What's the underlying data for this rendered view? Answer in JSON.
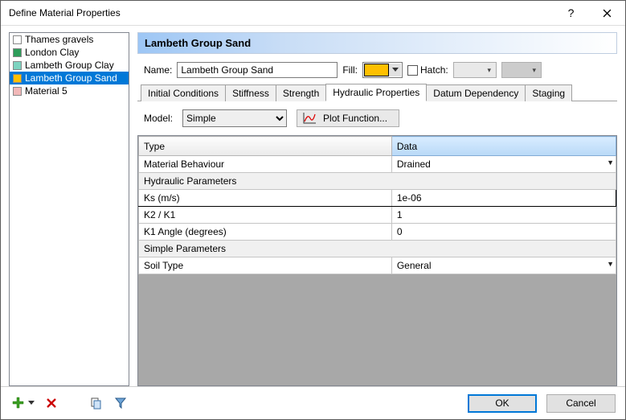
{
  "window": {
    "title": "Define Material Properties"
  },
  "sidebar": {
    "items": [
      {
        "label": "Thames gravels",
        "color": "#ffffff"
      },
      {
        "label": "London Clay",
        "color": "#2e9d5a"
      },
      {
        "label": "Lambeth Group Clay",
        "color": "#7dd3c0"
      },
      {
        "label": "Lambeth Group Sand",
        "color": "#ffc000"
      },
      {
        "label": "Material 5",
        "color": "#f2b8b8"
      }
    ],
    "selected_index": 3
  },
  "header": {
    "title": "Lambeth Group Sand"
  },
  "form": {
    "name_label": "Name:",
    "name_value": "Lambeth Group Sand",
    "fill_label": "Fill:",
    "fill_color": "#ffc000",
    "hatch_label": "Hatch:"
  },
  "tabs": {
    "items": [
      "Initial Conditions",
      "Stiffness",
      "Strength",
      "Hydraulic Properties",
      "Datum Dependency",
      "Staging"
    ],
    "active_index": 3
  },
  "model_row": {
    "label": "Model:",
    "value": "Simple",
    "plot_btn": "Plot Function..."
  },
  "grid": {
    "headers": {
      "type": "Type",
      "data": "Data"
    },
    "rows": [
      {
        "kind": "row",
        "type": "Material Behaviour",
        "data": "Drained",
        "dropdown": true
      },
      {
        "kind": "group",
        "type": "Hydraulic Parameters"
      },
      {
        "kind": "row",
        "type": "Ks (m/s)",
        "data": "1e-06",
        "active": true,
        "indent": true
      },
      {
        "kind": "row",
        "type": "K2 / K1",
        "data": "1",
        "indent": true
      },
      {
        "kind": "row",
        "type": "K1 Angle (degrees)",
        "data": "0",
        "indent": true
      },
      {
        "kind": "group",
        "type": "Simple Parameters"
      },
      {
        "kind": "row",
        "type": "Soil Type",
        "data": "General",
        "dropdown": true,
        "indent": true
      }
    ]
  },
  "footer": {
    "ok": "OK",
    "cancel": "Cancel"
  }
}
